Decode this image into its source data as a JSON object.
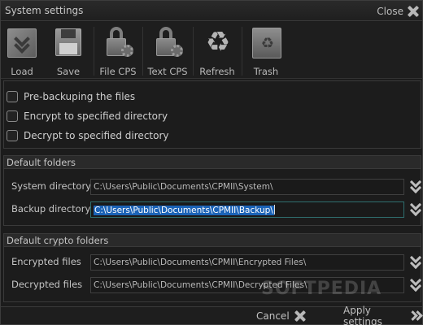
{
  "window": {
    "title": "System settings",
    "close_label": "Close"
  },
  "toolbar": {
    "items": [
      {
        "label": "Load",
        "icon": "load-icon"
      },
      {
        "label": "Save",
        "icon": "floppy-icon"
      },
      {
        "label": "File CPS",
        "icon": "lock-gear-icon"
      },
      {
        "label": "Text CPS",
        "icon": "lock-gear-icon"
      },
      {
        "label": "Refresh",
        "icon": "recycle-icon"
      },
      {
        "label": "Trash",
        "icon": "trash-icon"
      }
    ]
  },
  "options": {
    "pre_backup": {
      "label": "Pre-backuping the files",
      "checked": false
    },
    "encrypt": {
      "label": "Encrypt to specified directory",
      "checked": false
    },
    "decrypt": {
      "label": "Decrypt to specified directory",
      "checked": false
    }
  },
  "default_folders": {
    "header": "Default folders",
    "system_directory": {
      "label": "System directory",
      "value": "C:\\Users\\Public\\Documents\\CPMII\\System\\"
    },
    "backup_directory": {
      "label": "Backup directory",
      "value": "C:\\Users\\Public\\Documents\\CPMII\\Backup\\"
    }
  },
  "crypto_folders": {
    "header": "Default crypto folders",
    "encrypted_files": {
      "label": "Encrypted files",
      "value": "C:\\Users\\Public\\Documents\\CPMII\\Encrypted Files\\"
    },
    "decrypted_files": {
      "label": "Decrypted files",
      "value": "C:\\Users\\Public\\Documents\\CPMII\\Decrypted Files\\"
    }
  },
  "footer": {
    "cancel_label": "Cancel",
    "apply_label": "Apply settings"
  },
  "watermark": "SOFTPEDIA"
}
